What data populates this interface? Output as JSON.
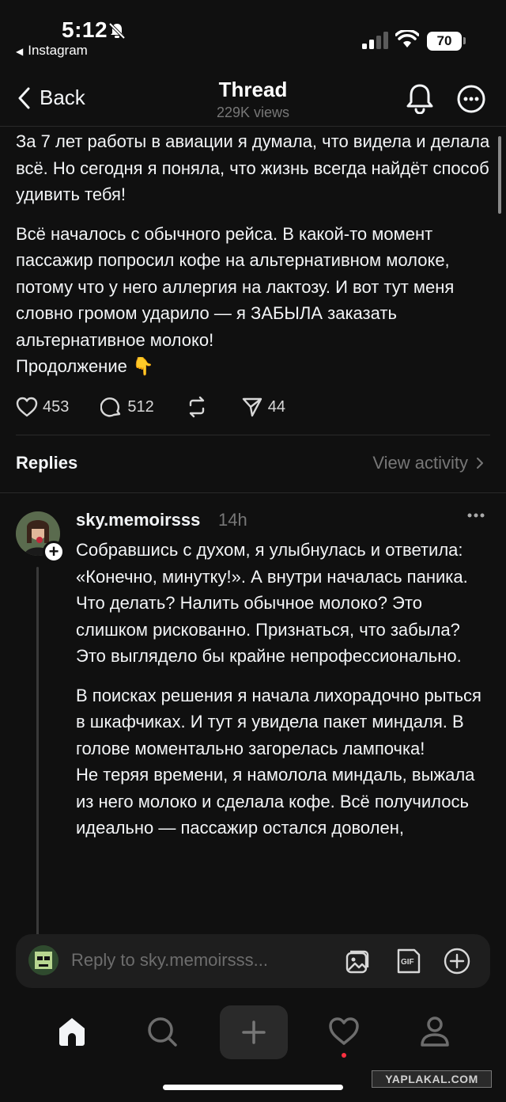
{
  "status_bar": {
    "time": "5:12",
    "back_app": "Instagram",
    "battery": "70"
  },
  "header": {
    "back_label": "Back",
    "title": "Thread",
    "views": "229K views"
  },
  "post": {
    "paragraph_1": "За 7 лет работы в авиации я думала, что видела и делала всё. Но сегодня я поняла, что жизнь всегда найдёт способ удивить тебя!",
    "paragraph_2": "Всё началось с обычного рейса. В какой-то момент пассажир попросил кофе на альтернативном молоке, потому что у него аллергия на лактозу. И вот тут меня словно громом ударило — я ЗАБЫЛА заказать альтернативное молоко!",
    "paragraph_3": "Продолжение 👇",
    "likes": "453",
    "comments": "512",
    "shares": "44"
  },
  "replies_section": {
    "label": "Replies",
    "view_activity": "View activity"
  },
  "reply": {
    "username": "sky.memoirsss",
    "time": "14h",
    "paragraph_1": "Собравшись с духом, я улыбнулась и ответила: «Конечно, минутку!». А внутри началась паника. Что делать? Налить обычное молоко? Это слишком рискованно. Признаться, что забыла? Это выглядело бы крайне непрофессионально.",
    "paragraph_2": "В поисках решения я начала лихорадочно рыться в шкафчиках. И тут я увидела пакет миндаля. В голове моментально загорелась лампочка!",
    "paragraph_3": "Не теряя времени, я намолола миндаль, выжала из него молоко и сделала кофе. Всё получилось идеально — пассажир остался доволен,"
  },
  "composer": {
    "placeholder": "Reply to sky.memoirsss..."
  },
  "icons": {
    "back": "chevron-left-icon",
    "notifications": "bell-icon",
    "more": "more-circle-icon",
    "like": "heart-icon",
    "comment": "comment-icon",
    "repost": "repost-icon",
    "share": "send-icon",
    "nav": [
      "home-icon",
      "search-icon",
      "plus-icon",
      "heart-icon",
      "profile-icon"
    ]
  },
  "watermark": "YAPLAKAL.COM",
  "colors": {
    "background": "#101010",
    "text": "#f3f5f7",
    "muted": "#777777",
    "notification_dot": "#ff3040"
  }
}
